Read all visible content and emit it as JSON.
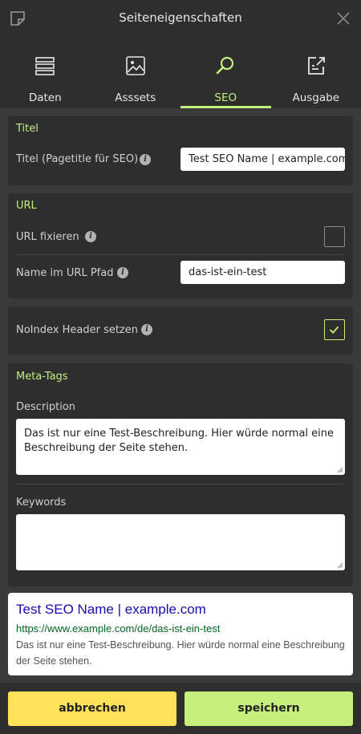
{
  "header": {
    "title": "Seiteneigenschaften"
  },
  "tabs": [
    {
      "label": "Daten",
      "icon": "list-icon"
    },
    {
      "label": "Asssets",
      "icon": "image-icon"
    },
    {
      "label": "SEO",
      "icon": "search-icon",
      "active": true
    },
    {
      "label": "Ausgabe",
      "icon": "export-icon"
    }
  ],
  "titel_panel": {
    "heading": "Titel",
    "label": "Titel (Pagetitle für SEO)",
    "value": "Test SEO Name | example.com"
  },
  "url_panel": {
    "heading": "URL",
    "fix_label": "URL fixieren",
    "fix_checked": false,
    "path_label": "Name im URL Pfad",
    "path_value": "das-ist-ein-test"
  },
  "noindex_panel": {
    "label": "NoIndex Header setzen",
    "checked": true
  },
  "meta_panel": {
    "heading": "Meta-Tags",
    "description_label": "Description",
    "description_value": "Das ist nur eine Test-Beschreibung. Hier würde normal eine Beschreibung der Seite stehen.",
    "keywords_label": "Keywords",
    "keywords_value": ""
  },
  "preview": {
    "title": "Test SEO Name | example.com",
    "url": "https://www.example.com/de/das-ist-ein-test",
    "description": "Das ist nur eine Test-Beschreibung. Hier würde normal eine Beschreibung der Seite stehen."
  },
  "footer": {
    "cancel_label": "abbrechen",
    "save_label": "speichern"
  },
  "colors": {
    "accent": "#c6f07c",
    "cancel": "#ffe15a",
    "panel": "#2e2e2e",
    "background": "#3a3a3a"
  }
}
